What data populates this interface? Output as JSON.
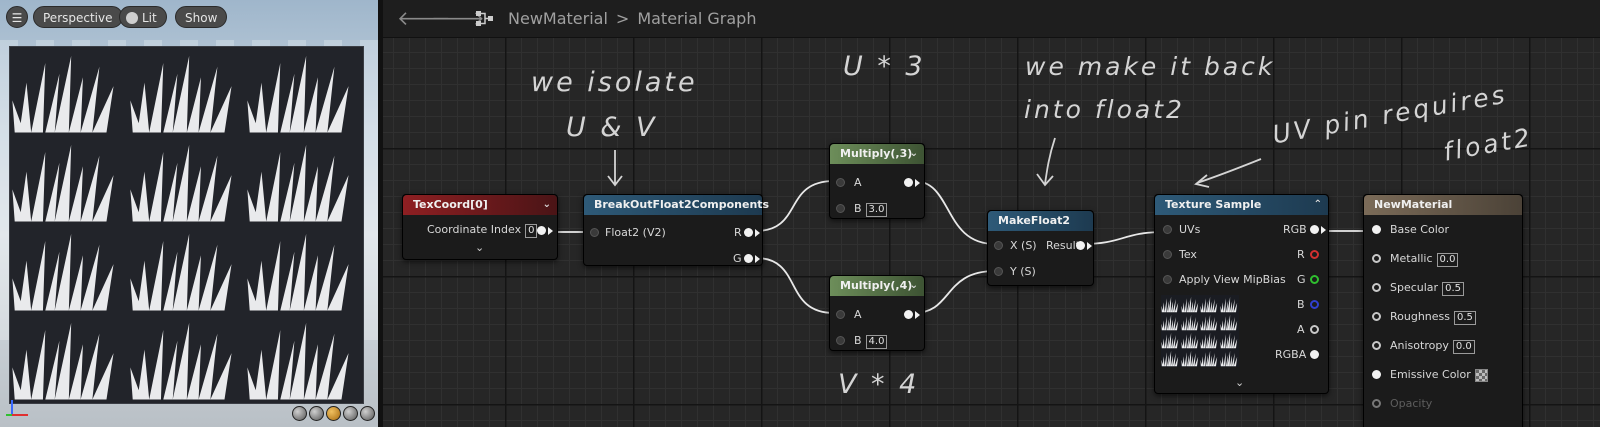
{
  "viewport": {
    "menu_icon": "hamburger-icon",
    "perspective_label": "Perspective",
    "lit_label": "Lit",
    "show_label": "Show"
  },
  "graph": {
    "breadcrumb_asset": "NewMaterial",
    "breadcrumb_separator": ">",
    "breadcrumb_graph": "Material Graph"
  },
  "annotations": {
    "isolate_line1": "we isolate",
    "isolate_line2": "U & V",
    "u_times": "U * 3",
    "v_times": "V * 4",
    "make_back_line1": "we make it back",
    "make_back_line2": "into float2",
    "uv_pin_line1": "UV pin requires",
    "uv_pin_line2": "float2"
  },
  "nodes": {
    "texcoord": {
      "title": "TexCoord[0]",
      "coordinate_index_label": "Coordinate Index",
      "coordinate_index_value": "0"
    },
    "breakout": {
      "title": "BreakOutFloat2Components",
      "input_label": "Float2 (V2)",
      "out_r": "R",
      "out_g": "G"
    },
    "multiply3": {
      "title": "Multiply(,3)",
      "a_label": "A",
      "b_label": "B",
      "b_value": "3.0"
    },
    "multiply4": {
      "title": "Multiply(,4)",
      "a_label": "A",
      "b_label": "B",
      "b_value": "4.0"
    },
    "makefloat2": {
      "title": "MakeFloat2",
      "x_label": "X (S)",
      "y_label": "Y (S)",
      "result_label": "Result"
    },
    "texsample": {
      "title": "Texture Sample",
      "uvs": "UVs",
      "tex": "Tex",
      "mip": "Apply View MipBias",
      "rgb": "RGB",
      "r": "R",
      "g": "G",
      "b": "B",
      "a": "A",
      "rgba": "RGBA"
    },
    "material": {
      "title": "NewMaterial",
      "base_color": "Base Color",
      "metallic": "Metallic",
      "metallic_value": "0.0",
      "specular": "Specular",
      "specular_value": "0.5",
      "roughness": "Roughness",
      "roughness_value": "0.5",
      "anisotropy": "Anisotropy",
      "anisotropy_value": "0.0",
      "emissive": "Emissive Color",
      "opacity": "Opacity"
    }
  }
}
